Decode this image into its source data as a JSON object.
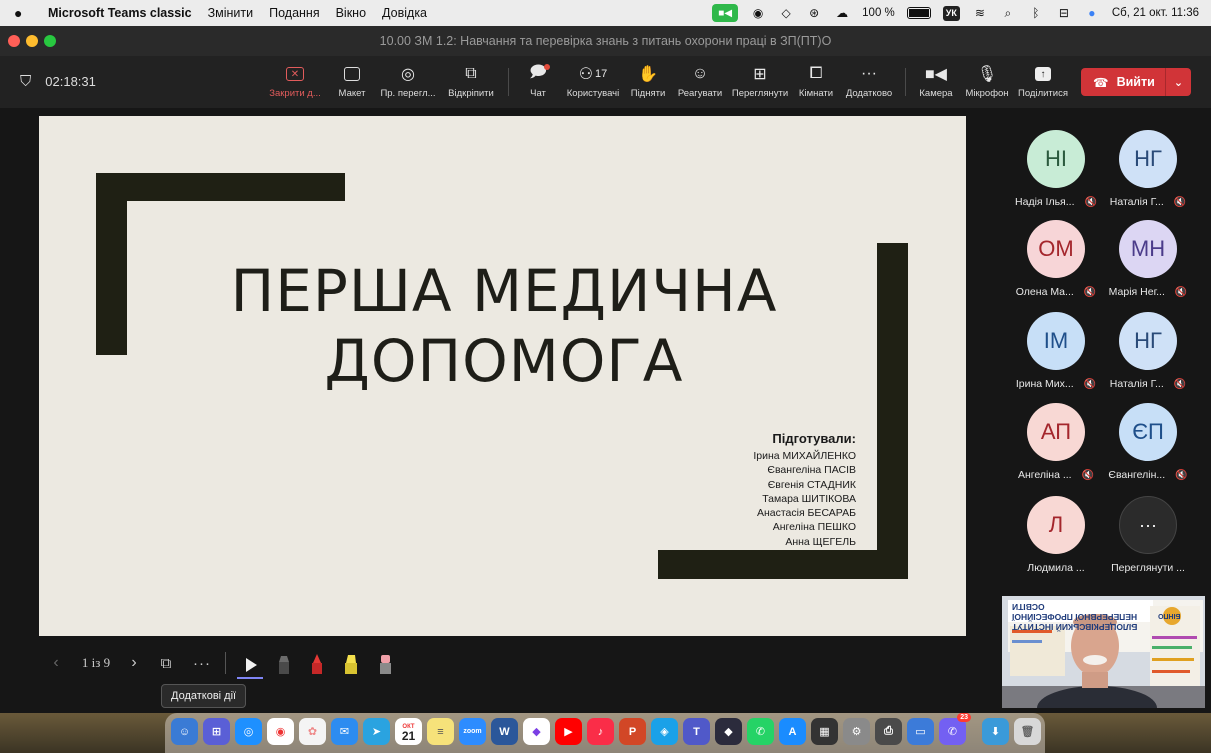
{
  "menubar": {
    "app_name": "Microsoft Teams classic",
    "menus": [
      "Змінити",
      "Подання",
      "Вікно",
      "Довідка"
    ],
    "battery": "100 %",
    "keyboard": "УК",
    "datetime": "Сб, 21 окт.  11:36"
  },
  "window": {
    "title": "10.00 ЗМ 1.2: Навчання та перевірка знань з питань охорони праці в ЗП(ПТ)О"
  },
  "meeting": {
    "elapsed": "02:18:31",
    "toolbar": {
      "stop_sharing": "Закрити д...",
      "layout": "Макет",
      "presenter_view": "Пр. перегл...",
      "pop_out": "Відкріпити",
      "chat": "Чат",
      "people": "Користувачі",
      "people_count": "17",
      "raise_hand": "Підняти",
      "react": "Реагувати",
      "view": "Переглянути",
      "rooms": "Кімнати",
      "more": "Додатково",
      "camera": "Камера",
      "mic": "Мікрофон",
      "share": "Поділитися",
      "leave": "Вийти"
    },
    "accent": "#d13438"
  },
  "slide": {
    "title_line1": "ПЕРША МЕДИЧНА",
    "title_line2": "ДОПОМОГА",
    "prepared_by": "Підготували:",
    "authors": [
      "Ірина МИХАЙЛЕНКО",
      "Євангеліна ПАСІВ",
      "Євгенія СТАДНИК",
      "Тамара ШИТІКОВА",
      "Анастасія БЕСАРАБ",
      "Ангеліна ПЕШКО",
      "Анна ЩЕГЕЛЬ"
    ]
  },
  "slide_nav": {
    "page": "1 із 9",
    "more_tooltip": "Додаткові дії"
  },
  "participants": [
    {
      "initials": "НІ",
      "name": "Надія Ілья...",
      "bg": "#c8ecd6",
      "fg": "#2b5a3e"
    },
    {
      "initials": "НГ",
      "name": "Наталія Г...",
      "bg": "#cfe1f7",
      "fg": "#2a4a78"
    },
    {
      "initials": "ОМ",
      "name": "Олена Ма...",
      "bg": "#f7d5d7",
      "fg": "#a4262c"
    },
    {
      "initials": "МН",
      "name": "Марія Нег...",
      "bg": "#dcd6f3",
      "fg": "#4b3c8a"
    },
    {
      "initials": "ІМ",
      "name": "Ірина Мих...",
      "bg": "#c7dff7",
      "fg": "#1f4f8a"
    },
    {
      "initials": "НГ",
      "name": "Наталія Г...",
      "bg": "#cfe1f7",
      "fg": "#2a4a78"
    },
    {
      "initials": "АП",
      "name": "Ангеліна ...",
      "bg": "#f8d8d4",
      "fg": "#a4262c"
    },
    {
      "initials": "ЄП",
      "name": "Євангелін...",
      "bg": "#c7dff7",
      "fg": "#1f4f8a"
    },
    {
      "initials": "Л",
      "name": "Людмила ...",
      "bg": "#f8d8d4",
      "fg": "#a4262c"
    },
    {
      "initials": "···",
      "name": "Переглянути ...",
      "bg": "#2b2b2b",
      "fg": "#ffffff"
    }
  ],
  "self_video": {
    "banner_line1": "БІЛОЦЕРКІВСЬКИЙ ІНСТИТУТ",
    "banner_line2": "НЕПЕРЕРВНОЇ ПРОФЕСІЙНОЇ ОСВІТИ",
    "logo": "БІНПО"
  },
  "dock": {
    "calendar_month": "ОКТ",
    "calendar_day": "21",
    "viber_badge": "23"
  }
}
